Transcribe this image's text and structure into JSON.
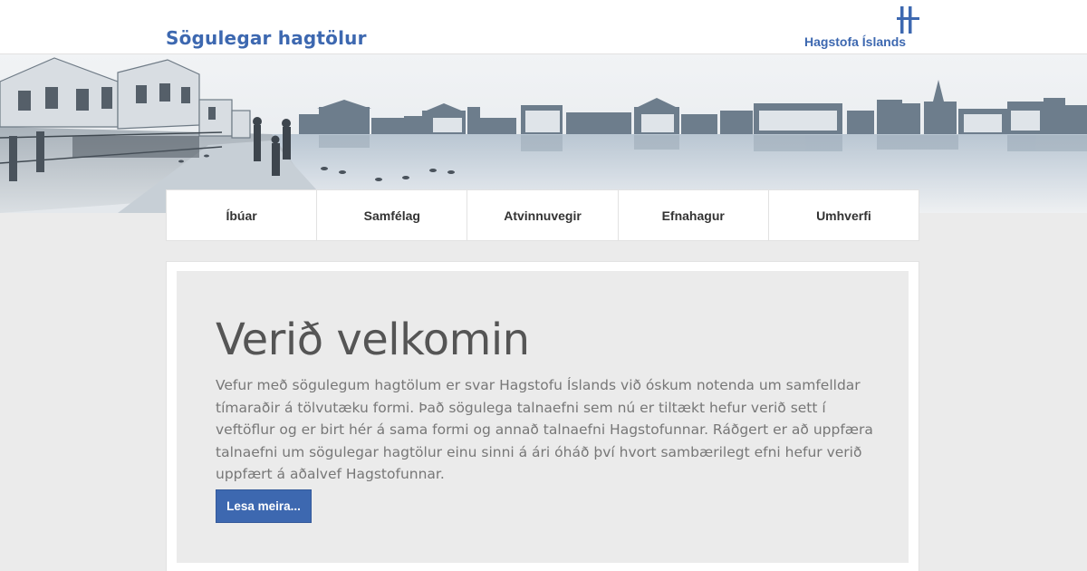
{
  "header": {
    "site_title": "Sögulegar hagtölur",
    "logo_text": "Hagstofa Íslands",
    "logo_icon": "hagstofa-logo-mark",
    "brand_color": "#3d68b0"
  },
  "hero": {
    "image": "historical-reykjavik-pond-panorama"
  },
  "nav": {
    "items": [
      {
        "label": "Íbúar"
      },
      {
        "label": "Samfélag"
      },
      {
        "label": "Atvinnuvegir"
      },
      {
        "label": "Efnahagur"
      },
      {
        "label": "Umhverfi"
      }
    ]
  },
  "main": {
    "heading": "Verið velkomin",
    "intro": "Vefur með sögulegum hagtölum er svar Hagstofu Íslands við óskum notenda um samfelldar tímaraðir á tölvutæku formi. Það sögulega talnaefni sem nú er tiltækt hefur verið sett í veftöflur og er birt hér á sama formi og annað talnaefni Hagstofunnar. Ráðgert er að uppfæra talnaefni um sögulegar hagtölur einu sinni á ári óháð því hvort sambærilegt efni hefur verið uppfært á aðalvef Hagstofunnar.",
    "read_more_label": "Lesa meira..."
  }
}
